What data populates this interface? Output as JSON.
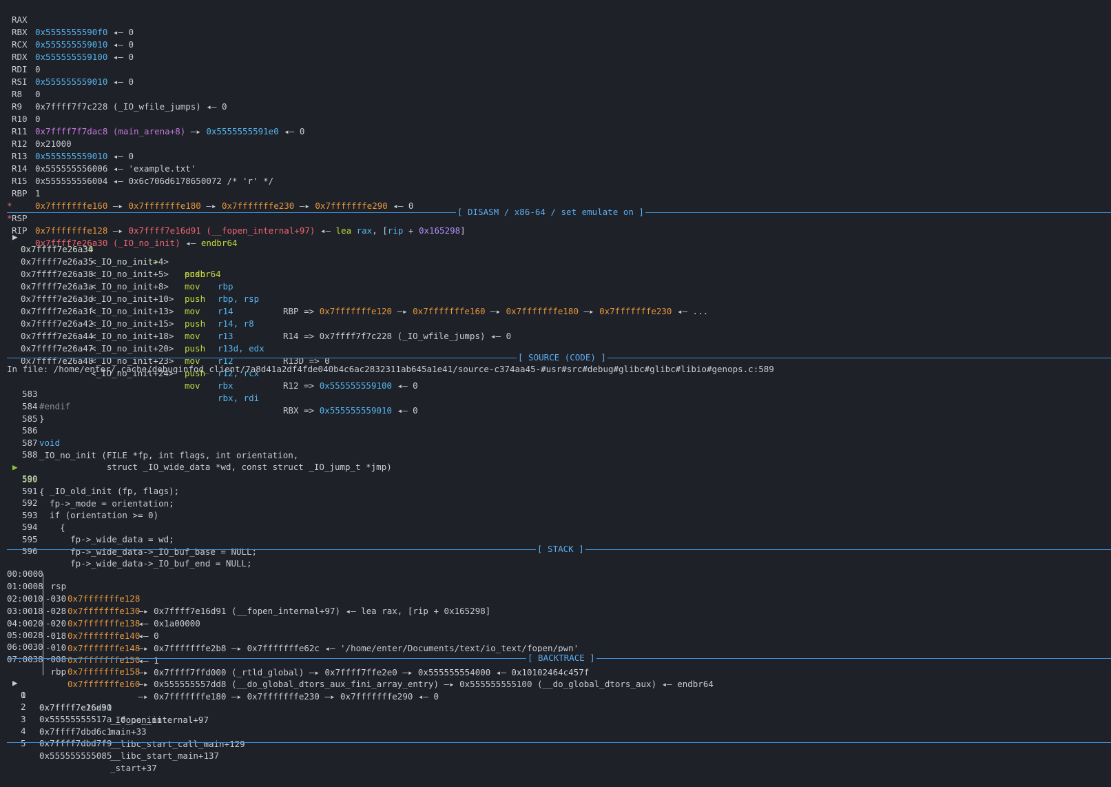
{
  "colors": {
    "background": "#1e2127",
    "text": "#c8ccd4",
    "pointer_blue": "#55b4f0",
    "stack_orange": "#e5963f",
    "code_red": "#ef6472",
    "data_magenta": "#c678dd",
    "instruction_yellow": "#c4d63f",
    "section_title": "#5aaef4"
  },
  "icons": {
    "current_marker": "right-pointing-triangle",
    "arrow": "right-arrow",
    "back_arrow": "left-arrow"
  },
  "registers": [
    {
      "name": "RAX",
      "v": "0x5555555590f0",
      "a1": " ◂— ",
      "r": "0"
    },
    {
      "name": "RBX",
      "v": "0x555555559010",
      "a1": " ◂— ",
      "r": "0"
    },
    {
      "name": "RCX",
      "v": "0x555555559100",
      "a1": " ◂— ",
      "r": "0"
    },
    {
      "name": "RDX",
      "v": "0"
    },
    {
      "name": "RDI",
      "v": "0x555555559010",
      "a1": " ◂— ",
      "r": "0"
    },
    {
      "name": "RSI",
      "v": "0"
    },
    {
      "name": "R8",
      "v": "0x7ffff7f7c228 (_IO_wfile_jumps)",
      "a1": " ◂— ",
      "r": "0"
    },
    {
      "name": "R9",
      "v": "0"
    },
    {
      "name": "R10",
      "v": "0x7ffff7f7dac8 (main_arena+8)",
      "a1": " —▸ ",
      "v2": "0x5555555591e0",
      "a2": " ◂— ",
      "r": "0"
    },
    {
      "name": "R11",
      "v": "0x21000"
    },
    {
      "name": "R12",
      "v": "0x555555559010",
      "a1": " ◂— ",
      "r": "0"
    },
    {
      "name": "R13",
      "v": "0x555555556006",
      "a1": " ◂— ",
      "r": "'example.txt'"
    },
    {
      "name": "R14",
      "v": "0x555555556004",
      "a1": " ◂— ",
      "r": "0x6c706d6178650072 /* 'r' */"
    },
    {
      "name": "R15",
      "v": "1"
    },
    {
      "name": "RBP",
      "v": "0x7fffffffe160",
      "a1": " —▸ ",
      "v2": "0x7fffffffe180",
      "a2": " —▸ ",
      "v3": "0x7fffffffe230",
      "a3": " —▸ ",
      "v4": "0x7fffffffe290",
      "a4": " ◂— ",
      "r": "0"
    },
    {
      "name": "RSP",
      "mark": "*",
      "v": "0x7fffffffe128",
      "a1": " —▸ ",
      "v2": "0x7ffff7e16d91 (__fopen_internal+97)",
      "a2": " ◂— ",
      "i1": "lea ",
      "i2": "rax",
      "i3": ", [",
      "i4": "rip",
      "i5": " + ",
      "i6": "0x165298",
      "i7": "]"
    },
    {
      "name": "RIP",
      "mark": "*",
      "v": "0x7ffff7e26a30 (_IO_no_init)",
      "a1": " ◂— ",
      "i1": "endbr64"
    }
  ],
  "disasm": {
    "title": "[ DISASM / x86-64 / set emulate on ]",
    "lines": [
      {
        "addr": "0x7ffff7e26a30",
        "sym": "<_IO_no_init>",
        "mn": "endbr64",
        "op": "",
        "comment": ""
      },
      {
        "addr": "0x7ffff7e26a34",
        "sym": "<_IO_no_init+4>",
        "mn": "push",
        "op": "rbp",
        "comment": ""
      },
      {
        "addr": "0x7ffff7e26a35",
        "sym": "<_IO_no_init+5>",
        "mn": "mov",
        "op": "rbp, rsp",
        "comment": "RBP => ",
        "c1": "0x7fffffffe120",
        "c2": " —▸ ",
        "c3": "0x7fffffffe160",
        "c4": " —▸ ",
        "c5": "0x7fffffffe180",
        "c6": " —▸ ",
        "c7": "0x7fffffffe230",
        "c8": " ◂— ..."
      },
      {
        "addr": "0x7ffff7e26a38",
        "sym": "<_IO_no_init+8>",
        "mn": "push",
        "op": "r14",
        "comment": ""
      },
      {
        "addr": "0x7ffff7e26a3a",
        "sym": "<_IO_no_init+10>",
        "mn": "mov",
        "op": "r14, r8",
        "comment": "R14 => 0x7ffff7f7c228 (_IO_wfile_jumps) ◂— 0"
      },
      {
        "addr": "0x7ffff7e26a3d",
        "sym": "<_IO_no_init+13>",
        "mn": "push",
        "op": "r13",
        "comment": ""
      },
      {
        "addr": "0x7ffff7e26a3f",
        "sym": "<_IO_no_init+15>",
        "mn": "mov",
        "op": "r13d, edx",
        "comment": "R13D => 0"
      },
      {
        "addr": "0x7ffff7e26a42",
        "sym": "<_IO_no_init+18>",
        "mn": "push",
        "op": "r12",
        "comment": ""
      },
      {
        "addr": "0x7ffff7e26a44",
        "sym": "<_IO_no_init+20>",
        "mn": "mov",
        "op": "r12, rcx",
        "comment": "R12 => ",
        "c1": "0x555555559100",
        "c8": " ◂— 0"
      },
      {
        "addr": "0x7ffff7e26a47",
        "sym": "<_IO_no_init+23>",
        "mn": "push",
        "op": "rbx",
        "comment": ""
      },
      {
        "addr": "0x7ffff7e26a48",
        "sym": "<_IO_no_init+24>",
        "mn": "mov",
        "op": "rbx, rdi",
        "comment": "RBX => ",
        "c1": "0x555555559010",
        "c8": " ◂— 0"
      }
    ]
  },
  "source": {
    "title": "[ SOURCE (CODE) ]",
    "file": "In file: /home/enter/.cache/debuginfod_client/7a8d41a2df4fde040b4c6ac2832311ab645a1e41/source-c374aa45-#usr#src#debug#glibc#glibc#libio#genops.c:589",
    "lines": [
      {
        "n": "583",
        "t": "#endif"
      },
      {
        "n": "584",
        "t": "}"
      },
      {
        "n": "585",
        "t": ""
      },
      {
        "n": "586",
        "t": "void"
      },
      {
        "n": "587",
        "t": "_IO_no_init (FILE *fp, int flags, int orientation,"
      },
      {
        "n": "588",
        "t": "             struct _IO_wide_data *wd, const struct _IO_jump_t *jmp)"
      },
      {
        "n": "589",
        "t": "{"
      },
      {
        "n": "590",
        "t": "  _IO_old_init (fp, flags);"
      },
      {
        "n": "591",
        "t": "  fp->_mode = orientation;"
      },
      {
        "n": "592",
        "t": "  if (orientation >= 0)"
      },
      {
        "n": "593",
        "t": "    {"
      },
      {
        "n": "594",
        "t": "      fp->_wide_data = wd;"
      },
      {
        "n": "595",
        "t": "      fp->_wide_data->_IO_buf_base = NULL;"
      },
      {
        "n": "596",
        "t": "      fp->_wide_data->_IO_buf_end = NULL;"
      }
    ]
  },
  "stack": {
    "title": "[ STACK ]",
    "lines": [
      {
        "idx": "00:0000",
        "off": " rsp",
        "addr": "0x7fffffffe128",
        "rest": " —▸ 0x7ffff7e16d91 (__fopen_internal+97) ◂— lea rax, [rip + 0x165298]"
      },
      {
        "idx": "01:0008",
        "off": "-030",
        "addr": "0x7fffffffe130",
        "rest": " ◂— 0x1a00000"
      },
      {
        "idx": "02:0010",
        "off": "-028",
        "addr": "0x7fffffffe138",
        "rest": " ◂— 0"
      },
      {
        "idx": "03:0018",
        "off": "-020",
        "addr": "0x7fffffffe140",
        "rest": " —▸ 0x7fffffffe2b8 —▸ 0x7fffffffe62c ◂— '/home/enter/Documents/text/io_text/fopen/pwn'"
      },
      {
        "idx": "04:0020",
        "off": "-018",
        "addr": "0x7fffffffe148",
        "rest": " ◂— 1"
      },
      {
        "idx": "05:0028",
        "off": "-010",
        "addr": "0x7fffffffe150",
        "rest": " —▸ 0x7ffff7ffd000 (_rtld_global) —▸ 0x7ffff7ffe2e0 —▸ 0x555555554000 ◂— 0x10102464c457f"
      },
      {
        "idx": "06:0030",
        "off": "-008",
        "addr": "0x7fffffffe158",
        "rest": " —▸ 0x555555557dd8 (__do_global_dtors_aux_fini_array_entry) —▸ 0x555555555100 (__do_global_dtors_aux) ◂— endbr64"
      },
      {
        "idx": "07:0038",
        "off": " rbp",
        "addr": "0x7fffffffe160",
        "rest": " —▸ 0x7fffffffe180 —▸ 0x7fffffffe230 —▸ 0x7fffffffe290 ◂— 0"
      }
    ]
  },
  "backtrace": {
    "title": "[ BACKTRACE ]",
    "frames": [
      {
        "n": "0",
        "addr": "0x7ffff7e26a30",
        "fn": "_IO_no_init"
      },
      {
        "n": "1",
        "addr": "0x7ffff7e16d91",
        "fn": "__fopen_internal+97"
      },
      {
        "n": "2",
        "addr": "0x55555555517a",
        "fn": "main+33"
      },
      {
        "n": "3",
        "addr": "0x7ffff7dbd6c1",
        "fn": "__libc_start_call_main+129"
      },
      {
        "n": "4",
        "addr": "0x7ffff7dbd7f9",
        "fn": "__libc_start_main+137"
      },
      {
        "n": "5",
        "addr": "0x555555555085",
        "fn": "_start+37"
      }
    ]
  }
}
